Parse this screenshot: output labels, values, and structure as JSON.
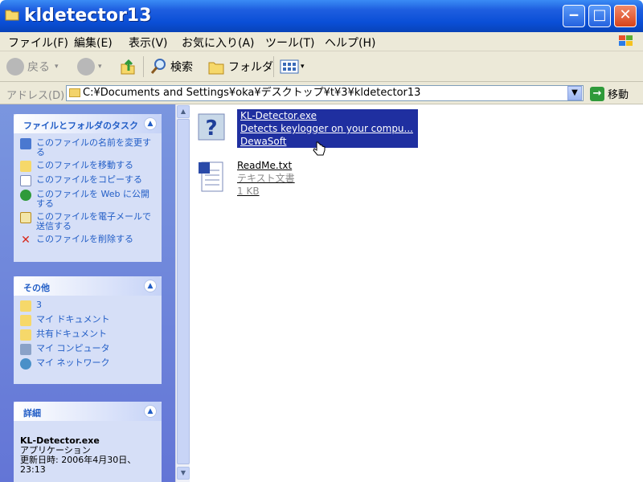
{
  "window": {
    "title": "kldetector13"
  },
  "menu": [
    "ファイル(F)",
    "編集(E)",
    "表示(V)",
    "お気に入り(A)",
    "ツール(T)",
    "ヘルプ(H)"
  ],
  "toolbar": {
    "back": "戻る",
    "search": "検索",
    "folders": "フォルダ"
  },
  "address": {
    "label": "アドレス(D)",
    "value": "C:¥Documents and Settings¥oka¥デスクトップ¥t¥3¥kldetector13",
    "go": "移動"
  },
  "tasks_panel": {
    "title": "ファイルとフォルダのタスク",
    "items": [
      "このファイルの名前を変更する",
      "このファイルを移動する",
      "このファイルをコピーする",
      "このファイルを Web に公開する",
      "このファイルを電子メールで送信する",
      "このファイルを削除する"
    ]
  },
  "other_panel": {
    "title": "その他",
    "items": [
      "3",
      "マイ ドキュメント",
      "共有ドキュメント",
      "マイ コンピュータ",
      "マイ ネットワーク"
    ]
  },
  "detail_panel": {
    "title": "詳細",
    "name": "KL-Detector.exe",
    "type": "アプリケーション",
    "modified": "更新日時: 2006年4月30日、23:13"
  },
  "files": [
    {
      "name": "KL-Detector.exe",
      "desc": "Detects keylogger on your compu...",
      "company": "DewaSoft"
    },
    {
      "name": "ReadMe.txt",
      "desc": "テキスト文書",
      "size": "1 KB"
    }
  ],
  "colors": {
    "titlebar": "#0a4fd6",
    "selection": "#1f2fa0",
    "link": "#215dc6",
    "pane": "#6375d6"
  }
}
